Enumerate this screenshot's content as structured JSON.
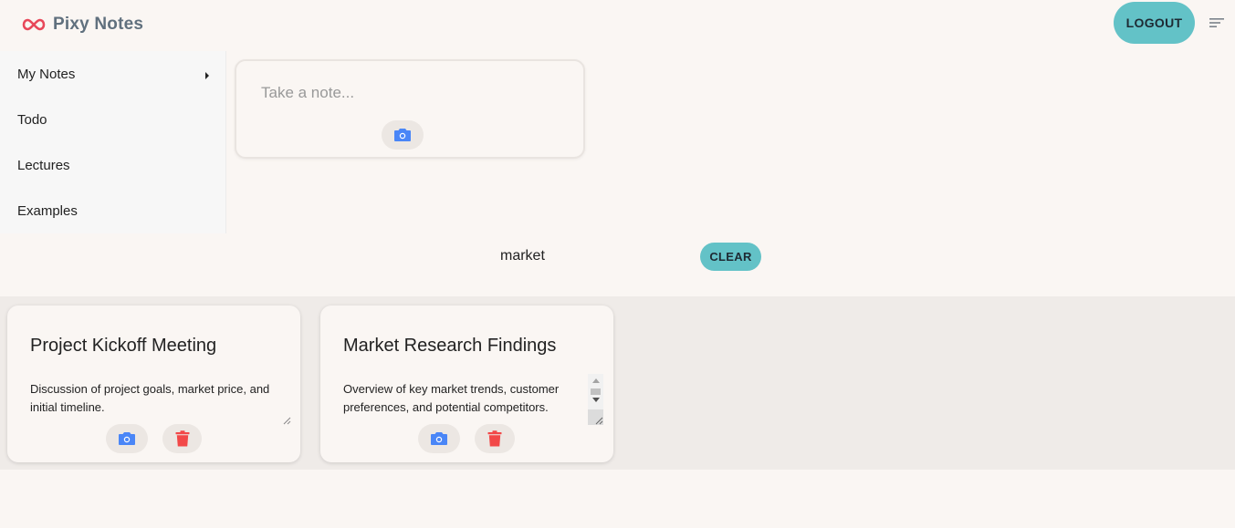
{
  "app": {
    "title": "Pixy Notes",
    "logo_icon": "infinity-icon",
    "accent_color": "#63c2c7",
    "logo_color": "#e8485a"
  },
  "header": {
    "logout_label": "LOGOUT",
    "menu_icon": "menu-icon"
  },
  "sidebar": {
    "items": [
      {
        "label": "My Notes",
        "icon": "chevron-right-icon"
      },
      {
        "label": "Todo"
      },
      {
        "label": "Lectures"
      },
      {
        "label": "Examples"
      }
    ]
  },
  "new_note": {
    "placeholder": "Take a note...",
    "camera_icon": "camera-icon"
  },
  "search": {
    "query": "market",
    "clear_label": "CLEAR"
  },
  "notes": [
    {
      "title": "Project Kickoff Meeting",
      "body": "Discussion of project goals, market price, and initial timeline.",
      "actions": [
        "camera-icon",
        "trash-icon"
      ]
    },
    {
      "title": "Market Research Findings",
      "body": "Overview of key market trends, customer preferences, and potential competitors.",
      "actions": [
        "camera-icon",
        "trash-icon"
      ]
    }
  ],
  "colors": {
    "camera": "#4a86f7",
    "trash": "#f24848",
    "page_bg": "#faf6f3",
    "band_bg": "#efebe8"
  }
}
